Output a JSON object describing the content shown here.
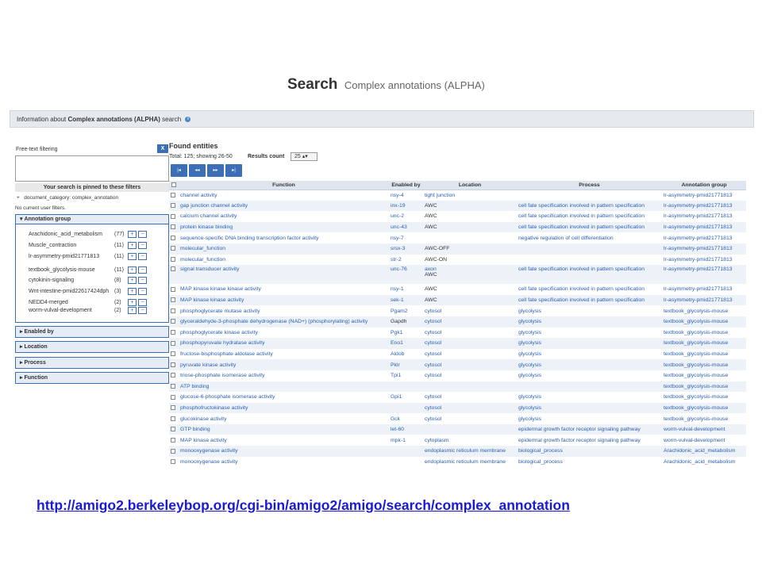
{
  "title": {
    "main": "Search",
    "sub": "Complex annotations (ALPHA)"
  },
  "info_bar": {
    "prefix": "Information about ",
    "bold": "Complex annotations (ALPHA)",
    "suffix": " search",
    "icon": "info-icon"
  },
  "left_panel": {
    "freetext_label": "Free-text filtering",
    "clear_label": "X",
    "freetext_value": "",
    "pinned_header": "Your search is pinned to these filters",
    "pinned_filter": "document_category: complex_annotation",
    "pinned_marker": "+",
    "no_filters": "No current user filters.",
    "annotation_group": {
      "label": "Annotation group",
      "items": [
        {
          "name": "Arachidonic_acid_metabolism",
          "count": "(77)"
        },
        {
          "name": "Muscle_contraction",
          "count": "(11)"
        },
        {
          "name": "lr-asymmetry-pmid21771813",
          "count": "(11)"
        },
        {
          "name": "textbook_glycolysis-mouse",
          "count": "(11)"
        },
        {
          "name": "cytokinin-signaling",
          "count": "(8)"
        },
        {
          "name": "Wnt-intestine-pmid22617424dph",
          "count": "(3)"
        },
        {
          "name": "NEDD4-merged",
          "count": "(2)"
        },
        {
          "name": "worm-vulval-development",
          "count": "(2)"
        }
      ],
      "plus": "+",
      "minus": "−"
    },
    "closed_facets": [
      "Enabled by",
      "Location",
      "Process",
      "Function"
    ]
  },
  "results": {
    "heading": "Found entities",
    "total": "Total: 125; showing 26-50",
    "results_count_label": "Results count",
    "results_count_value": "25 ▴▾",
    "pager": [
      "|◂",
      "◂◂",
      "▸▸",
      "▸|"
    ],
    "columns": [
      "Function",
      "Enabled by",
      "Location",
      "Process",
      "Annotation group"
    ],
    "rows": [
      {
        "function": "channel activity",
        "enabled_by": "nsy-4",
        "location": "tight junction",
        "process": "",
        "group": "lr-asymmetry-pmid21771813"
      },
      {
        "function": "gap junction channel activity",
        "enabled_by": "inx-19",
        "location": "AWC",
        "process": "cell fate specification involved in pattern specification",
        "group": "lr-asymmetry-pmid21771813"
      },
      {
        "function": "calcium channel activity",
        "enabled_by": "unc-2",
        "location": "AWC",
        "process": "cell fate specification involved in pattern specification",
        "group": "lr-asymmetry-pmid21771813"
      },
      {
        "function": "protein kinase binding",
        "enabled_by": "unc-43",
        "location": "AWC",
        "process": "cell fate specification involved in pattern specification",
        "group": "lr-asymmetry-pmid21771813"
      },
      {
        "function": "sequence-specific DNA binding transcription factor activity",
        "enabled_by": "nsy-7",
        "location": "",
        "process": "negative regulation of cell differentiation",
        "group": "lr-asymmetry-pmid21771813"
      },
      {
        "function": "molecular_function",
        "enabled_by": "srsx-3",
        "location": "AWC-OFF",
        "process": "",
        "group": "lr-asymmetry-pmid21771813"
      },
      {
        "function": "molecular_function",
        "enabled_by": "str-2",
        "location": "AWC-ON",
        "process": "",
        "group": "lr-asymmetry-pmid21771813"
      },
      {
        "function": "signal transducer activity",
        "enabled_by": "unc-76",
        "location": "axon",
        "location2": "AWC",
        "process": "cell fate specification involved in pattern specification",
        "group": "lr-asymmetry-pmid21771813"
      },
      {
        "function": "MAP kinase kinase kinase activity",
        "enabled_by": "nsy-1",
        "location": "AWC",
        "process": "cell fate specification involved in pattern specification",
        "group": "lr-asymmetry-pmid21771813"
      },
      {
        "function": "MAP kinase kinase activity",
        "enabled_by": "sek-1",
        "location": "AWC",
        "process": "cell fate specification involved in pattern specification",
        "group": "lr-asymmetry-pmid21771813"
      },
      {
        "function": "phosphoglycerate mutase activity",
        "enabled_by": "Pgam2",
        "location": "cytosol",
        "process": "glycolysis",
        "group": "textbook_glycolysis-mouse"
      },
      {
        "function": "glyceraldehyde-3-phosphate dehydrogenase (NAD+) (phosphorylating) activity",
        "enabled_by": "Gapdh",
        "location": "cytosol",
        "process": "glycolysis",
        "group": "textbook_glycolysis-mouse"
      },
      {
        "function": "phosphoglycerate kinase activity",
        "enabled_by": "Pgk1",
        "location": "cytosol",
        "process": "glycolysis",
        "group": "textbook_glycolysis-mouse"
      },
      {
        "function": "phosphopyruvate hydratase activity",
        "enabled_by": "Eno1",
        "location": "cytosol",
        "process": "glycolysis",
        "group": "textbook_glycolysis-mouse"
      },
      {
        "function": "fructose-bisphosphate aldolase activity",
        "enabled_by": "Aldob",
        "location": "cytosol",
        "process": "glycolysis",
        "group": "textbook_glycolysis-mouse"
      },
      {
        "function": "pyruvate kinase activity",
        "enabled_by": "Pklr",
        "location": "cytosol",
        "process": "glycolysis",
        "group": "textbook_glycolysis-mouse"
      },
      {
        "function": "triose-phosphate isomerase activity",
        "enabled_by": "Tpi1",
        "location": "cytosol",
        "process": "glycolysis",
        "group": "textbook_glycolysis-mouse"
      },
      {
        "function": "ATP binding",
        "enabled_by": "",
        "location": "",
        "process": "",
        "group": "textbook_glycolysis-mouse"
      },
      {
        "function": "glucose-6-phosphate isomerase activity",
        "enabled_by": "Gpi1",
        "location": "cytosol",
        "process": "glycolysis",
        "group": "textbook_glycolysis-mouse"
      },
      {
        "function": "phosphofructokinase activity",
        "enabled_by": "",
        "location": "cytosol",
        "process": "glycolysis",
        "group": "textbook_glycolysis-mouse"
      },
      {
        "function": "glucokinase activity",
        "enabled_by": "Gck",
        "location": "cytosol",
        "process": "glycolysis",
        "group": "textbook_glycolysis-mouse"
      },
      {
        "function": "GTP binding",
        "enabled_by": "let-60",
        "location": "",
        "process": "epidermal growth factor receptor signaling pathway",
        "group": "worm-vulval-development"
      },
      {
        "function": "MAP kinase activity",
        "enabled_by": "mpk-1",
        "location": "cytoplasm",
        "process": "epidermal growth factor receptor signaling pathway",
        "group": "worm-vulval-development"
      },
      {
        "function": "monooxygenase activity",
        "enabled_by": "",
        "location": "endoplasmic reticulum membrane",
        "process": "biological_process",
        "group": "Arachidonic_acid_metabolism"
      },
      {
        "function": "monooxygenase activity",
        "enabled_by": "",
        "location": "endoplasmic reticulum membrane",
        "process": "biological_process",
        "group": "Arachidonic_acid_metabolism"
      }
    ]
  },
  "footer_url": "http://amigo2.berkeleybop.org/cgi-bin/amigo2/amigo/search/complex_annotation"
}
